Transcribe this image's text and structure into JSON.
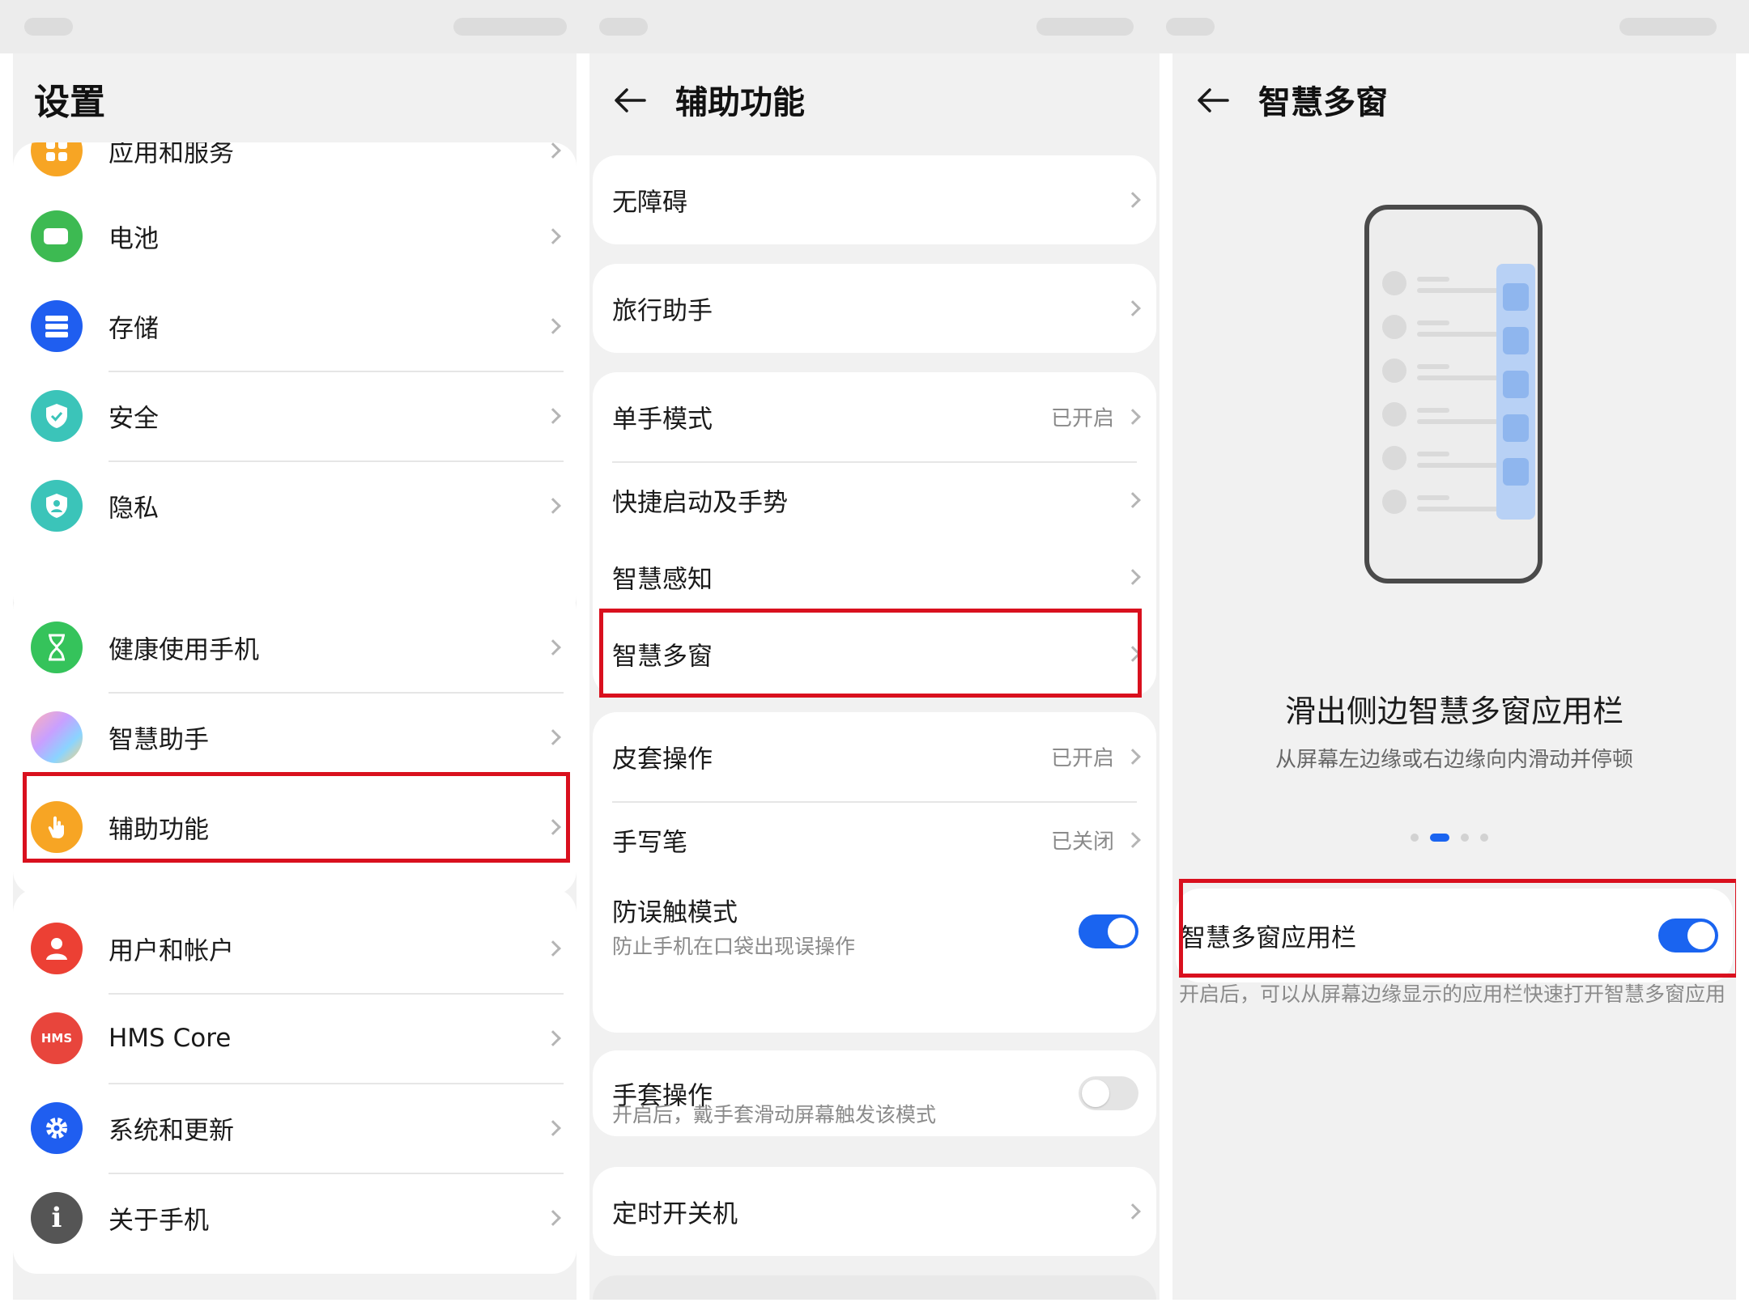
{
  "settings": {
    "title": "设置",
    "group1": [
      {
        "label": "应用和服务",
        "icon": "apps-icon"
      },
      {
        "label": "电池",
        "icon": "battery-icon"
      },
      {
        "label": "存储",
        "icon": "storage-icon"
      },
      {
        "label": "安全",
        "icon": "shield-icon"
      },
      {
        "label": "隐私",
        "icon": "privacy-icon"
      }
    ],
    "group2": [
      {
        "label": "健康使用手机",
        "icon": "hourglass-icon"
      },
      {
        "label": "智慧助手",
        "icon": "assistant-icon"
      },
      {
        "label": "辅助功能",
        "icon": "hand-touch-icon"
      }
    ],
    "group3": [
      {
        "label": "用户和帐户",
        "icon": "user-icon"
      },
      {
        "label": "HMS Core",
        "icon": "hms-icon",
        "icon_text": "HMS"
      },
      {
        "label": "系统和更新",
        "icon": "gear-icon"
      },
      {
        "label": "关于手机",
        "icon": "info-icon",
        "icon_text": "i"
      }
    ]
  },
  "accessibility": {
    "title": "辅助功能",
    "items": {
      "barrier_free": "无障碍",
      "travel": "旅行助手",
      "one_hand": {
        "label": "单手模式",
        "value": "已开启"
      },
      "shortcuts": "快捷启动及手势",
      "smart_sense": "智慧感知",
      "multi_window": "智慧多窗",
      "cover": {
        "label": "皮套操作",
        "value": "已开启"
      },
      "stylus": {
        "label": "手写笔",
        "value": "已关闭"
      },
      "anti_touch": {
        "label": "防误触模式",
        "sub": "防止手机在口袋出现误操作",
        "on": true
      },
      "glove": {
        "label": "手套操作",
        "on": false
      },
      "glove_note": "开启后，戴手套滑动屏幕触发该模式",
      "timer_power": "定时开关机"
    }
  },
  "multiwindow": {
    "title": "智慧多窗",
    "hero_title": "滑出侧边智慧多窗应用栏",
    "hero_sub": "从屏幕左边缘或右边缘向内滑动并停顿",
    "page_dots": {
      "count": 4,
      "active": 2
    },
    "toggle_label": "智慧多窗应用栏",
    "toggle_on": true,
    "note": "开启后，可以从屏幕边缘显示的应用栏快速打开智慧多窗应用"
  },
  "colors": {
    "accent": "#1a64f0",
    "highlight": "#d9101e",
    "apps": "#f7a524",
    "battery": "#3dba52",
    "storage": "#1f5ef0",
    "security": "#3bc4b9",
    "privacy": "#3bc4b9",
    "health": "#35c35b",
    "accessibility": "#f7a524",
    "user": "#ec4034",
    "hms": "#e8453c",
    "system": "#1f5ef0",
    "about": "#555555"
  }
}
